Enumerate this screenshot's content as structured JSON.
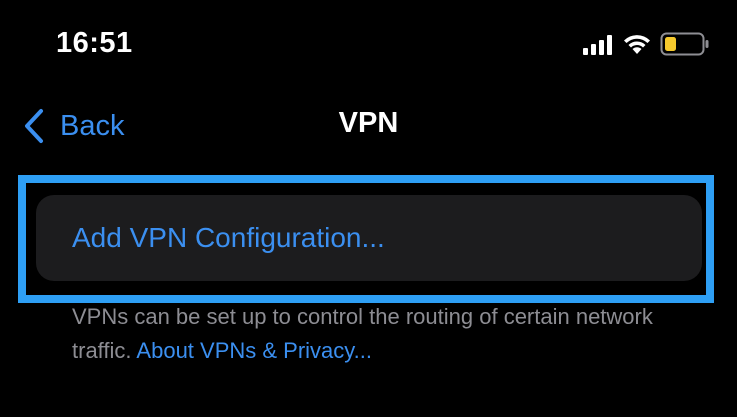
{
  "status_bar": {
    "time": "16:51",
    "icons": [
      "cellular-signal-icon",
      "wifi-icon",
      "battery-low-icon"
    ],
    "battery_color": "#f5c92d"
  },
  "nav": {
    "back_label": "Back",
    "title": "VPN"
  },
  "vpn_section": {
    "add_config_label": "Add VPN Configuration...",
    "footer_text": "VPNs can be set up to control the routing of certain network traffic.",
    "footer_link": "About VPNs & Privacy..."
  },
  "colors": {
    "accent": "#3b8ff0",
    "highlight": "#2e9ff5",
    "cell_bg": "#1c1c1e",
    "footer_text": "#8d8d93"
  }
}
